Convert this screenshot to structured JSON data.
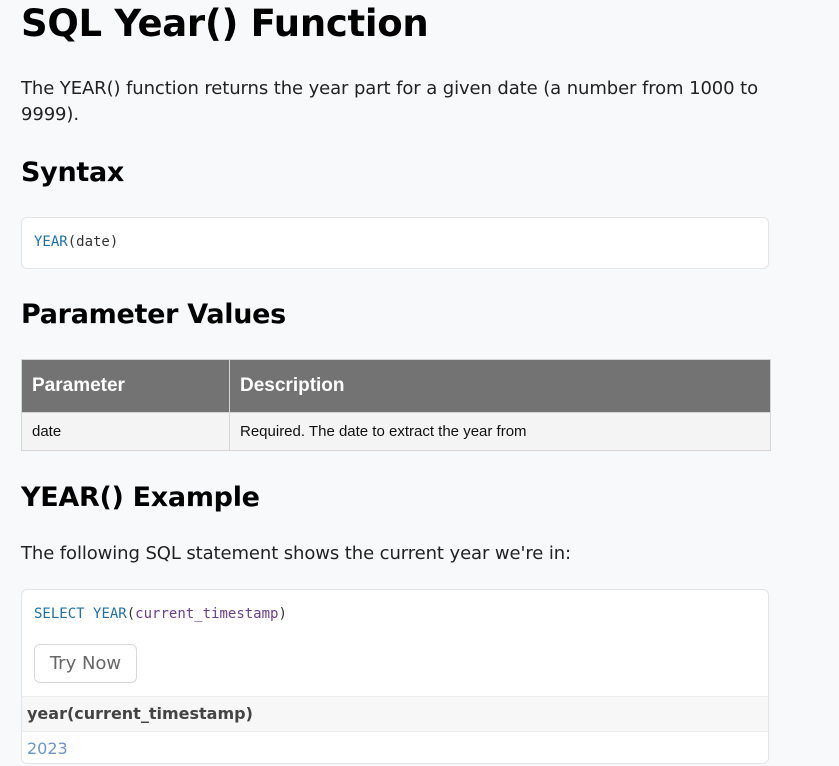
{
  "page": {
    "title": "SQL Year() Function",
    "description": "The YEAR() function returns the year part for a given date (a number from 1000 to 9999)."
  },
  "syntax": {
    "heading": "Syntax",
    "code_fn": "YEAR",
    "code_args": "(date)"
  },
  "parameters": {
    "heading": "Parameter Values",
    "headers": [
      "Parameter",
      "Description"
    ],
    "rows": [
      [
        "date",
        "Required. The date to extract the year from"
      ]
    ]
  },
  "example": {
    "heading": "YEAR() Example",
    "description": "The following SQL statement shows the current year we're in:",
    "code_kw": "SELECT",
    "code_fn": "YEAR",
    "code_open": "(",
    "code_arg": "current_timestamp",
    "code_close": ")",
    "try_button": "Try Now",
    "result_column": "year(current_timestamp)",
    "result_value": "2023"
  },
  "colors": {
    "keyword": "#1e6fa8",
    "argument": "#6b3e8f",
    "table_header": "#737373",
    "result_value": "#6c95c7",
    "page_background": "#f8f9fa"
  }
}
